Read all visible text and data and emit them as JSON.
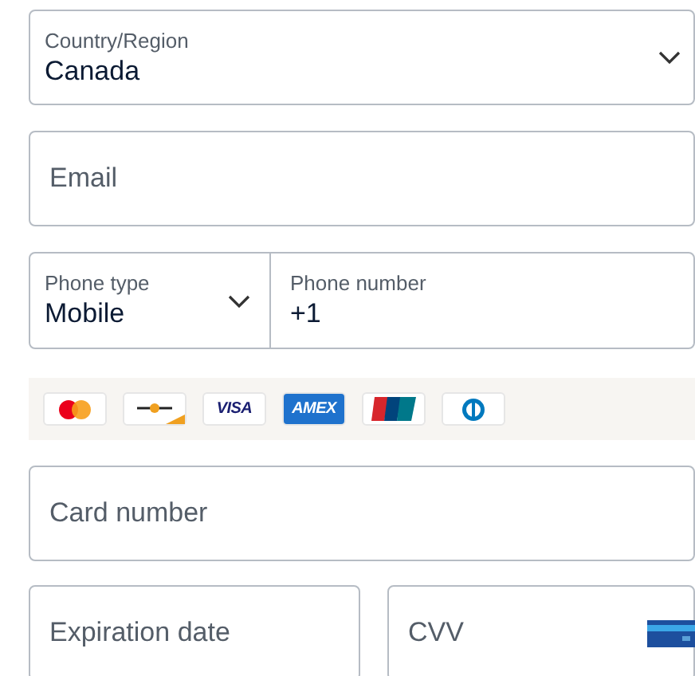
{
  "country": {
    "label": "Country/Region",
    "value": "Canada"
  },
  "email": {
    "placeholder": "Email"
  },
  "phone_type": {
    "label": "Phone type",
    "value": "Mobile"
  },
  "phone_number": {
    "label": "Phone number",
    "value": "+1"
  },
  "card_brands": [
    {
      "kind": "mastercard"
    },
    {
      "kind": "maestro"
    },
    {
      "kind": "visa",
      "label": "VISA"
    },
    {
      "kind": "amex",
      "label": "AMEX"
    },
    {
      "kind": "unionpay"
    },
    {
      "kind": "diners"
    }
  ],
  "card_number": {
    "placeholder": "Card number"
  },
  "expiration": {
    "placeholder": "Expiration date"
  },
  "cvv": {
    "placeholder": "CVV"
  }
}
